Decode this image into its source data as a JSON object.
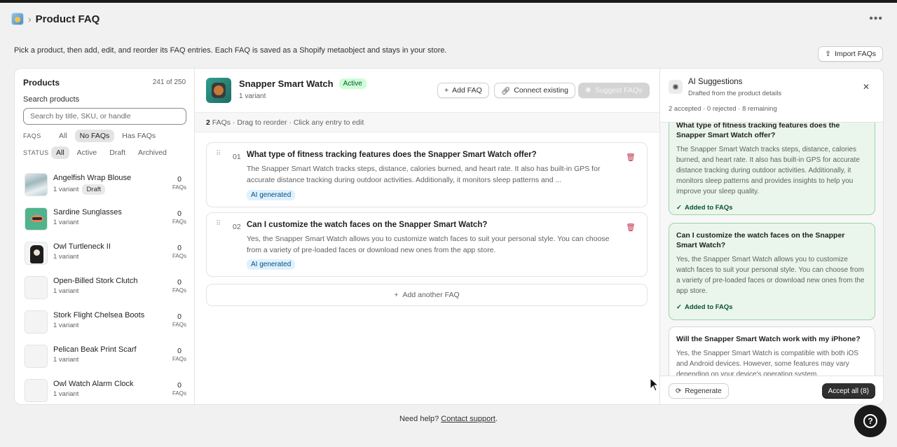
{
  "header": {
    "page_title": "Product FAQ",
    "breadcrumb_sep": "›",
    "more_icon": "more-horizontal-icon"
  },
  "intro": {
    "text": "Pick a product, then add, edit, and reorder its FAQ entries. Each FAQ is saved as a Shopify metaobject and stays in your store.",
    "import_label": "Import FAQs"
  },
  "products_panel": {
    "title": "Products",
    "count": "241 of 250",
    "search_label": "Search products",
    "search_placeholder": "Search by title, SKU, or handle",
    "faq_filter_label": "FAQS",
    "faq_filters": [
      "All",
      "No FAQs",
      "Has FAQs"
    ],
    "faq_filter_selected": "No FAQs",
    "status_filter_label": "STATUS",
    "status_filters": [
      "All",
      "Active",
      "Draft",
      "Archived"
    ],
    "status_filter_selected": "All",
    "items": [
      {
        "name": "Angelfish Wrap Blouse",
        "variants": "1 variant",
        "badge": "Draft",
        "faq_count": "0",
        "faq_label": "FAQs"
      },
      {
        "name": "Sardine Sunglasses",
        "variants": "1 variant",
        "badge": "",
        "faq_count": "0",
        "faq_label": "FAQs"
      },
      {
        "name": "Owl Turtleneck II",
        "variants": "1 variant",
        "badge": "",
        "faq_count": "0",
        "faq_label": "FAQs"
      },
      {
        "name": "Open-Billed Stork Clutch",
        "variants": "1 variant",
        "badge": "",
        "faq_count": "0",
        "faq_label": "FAQs"
      },
      {
        "name": "Stork Flight Chelsea Boots",
        "variants": "1 variant",
        "badge": "",
        "faq_count": "0",
        "faq_label": "FAQs"
      },
      {
        "name": "Pelican Beak Print Scarf",
        "variants": "1 variant",
        "badge": "",
        "faq_count": "0",
        "faq_label": "FAQs"
      },
      {
        "name": "Owl Watch Alarm Clock",
        "variants": "1 variant",
        "badge": "",
        "faq_count": "0",
        "faq_label": "FAQs"
      }
    ]
  },
  "product_detail": {
    "title": "Snapper Smart Watch",
    "status": "Active",
    "variants": "1 variant",
    "add_faq_label": "Add FAQ",
    "connect_label": "Connect existing",
    "suggest_label": "Suggest FAQs",
    "faq_count": "2",
    "faq_bar_text": " FAQs · Drag to reorder · Click any entry to edit",
    "faqs": [
      {
        "num": "01",
        "question": "What type of fitness tracking features does the Snapper Smart Watch offer?",
        "answer": "The Snapper Smart Watch tracks steps, distance, calories burned, and heart rate. It also has built-in GPS for accurate distance tracking during outdoor activities. Additionally, it monitors sleep patterns and ...",
        "badge": "AI generated"
      },
      {
        "num": "02",
        "question": "Can I customize the watch faces on the Snapper Smart Watch?",
        "answer": "Yes, the Snapper Smart Watch allows you to customize watch faces to suit your personal style. You can choose from a variety of pre-loaded faces or download new ones from the app store.",
        "badge": "AI generated"
      }
    ],
    "add_another_label": "Add another FAQ"
  },
  "ai_panel": {
    "title": "AI Suggestions",
    "subtitle": "Drafted from the product details",
    "stats": "2 accepted · 0 rejected · 8 remaining",
    "suggestions": [
      {
        "question": "What type of fitness tracking features does the Snapper Smart Watch offer?",
        "answer": "The Snapper Smart Watch tracks steps, distance, calories burned, and heart rate. It also has built-in GPS for accurate distance tracking during outdoor activities. Additionally, it monitors sleep patterns and provides insights to help you improve your sleep quality.",
        "status": "Added to FAQs"
      },
      {
        "question": "Can I customize the watch faces on the Snapper Smart Watch?",
        "answer": "Yes, the Snapper Smart Watch allows you to customize watch faces to suit your personal style. You can choose from a variety of pre-loaded faces or download new ones from the app store.",
        "status": "Added to FAQs"
      },
      {
        "question": "Will the Snapper Smart Watch work with my iPhone?",
        "answer": "Yes, the Snapper Smart Watch is compatible with both iOS and Android devices. However, some features may vary depending on your device's operating system.",
        "status": ""
      }
    ],
    "regenerate_label": "Regenerate",
    "accept_all_label": "Accept all (8)"
  },
  "footer": {
    "text": "Need help? ",
    "link": "Contact support",
    "end": "."
  },
  "colors": {
    "accent_green_bg": "#cdfed4",
    "ai_badge_bg": "#e0f0ff",
    "accepted_bg": "#eaf6ec",
    "danger": "#c4314b"
  }
}
